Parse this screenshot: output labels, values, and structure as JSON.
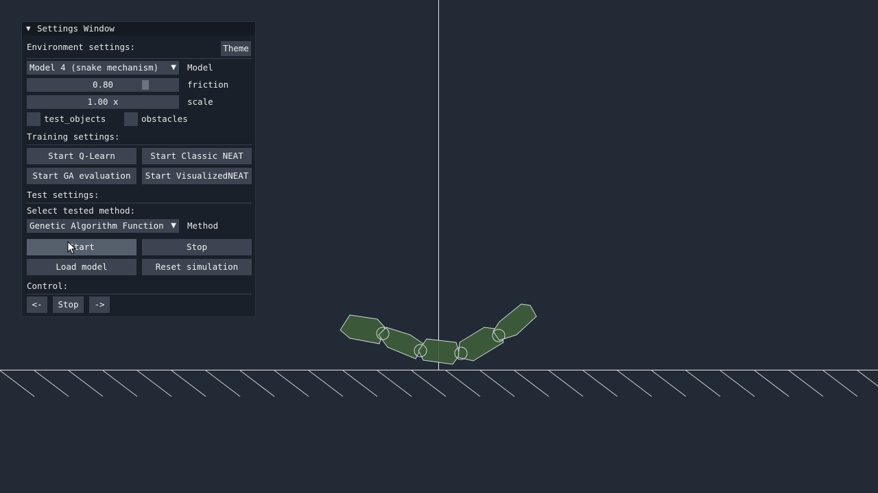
{
  "window": {
    "title": "Settings Window",
    "environment": {
      "heading": "Environment settings:",
      "theme_button": "Theme",
      "model_value": "Model 4 (snake mechanism)",
      "model_label": "Model",
      "friction_value": "0.80",
      "friction_label": "friction",
      "friction_level": 0.8,
      "scale_value": "1.00 x",
      "scale_label": "scale",
      "test_objects_label": "test_objects",
      "test_objects_checked": false,
      "obstacles_label": "obstacles",
      "obstacles_checked": false
    },
    "training": {
      "heading": "Training settings:",
      "start_qlearn": "Start Q-Learn",
      "start_classic_neat": "Start Classic NEAT",
      "start_ga_evaluation": "Start GA evaluation",
      "start_visualized_neat": "Start VisualizedNEAT"
    },
    "test": {
      "heading": "Test settings:",
      "select_label": "Select tested method:",
      "method_value": "Genetic Algorithm Function",
      "method_label": "Method",
      "start_button": "Start",
      "stop_button": "Stop",
      "load_model_button": "Load model",
      "reset_simulation_button": "Reset simulation"
    },
    "control": {
      "heading": "Control:",
      "left_button": "<-",
      "stop_button": "Stop",
      "right_button": "->"
    }
  },
  "colors": {
    "background": "#222a35",
    "window_bg": "#192029",
    "button_bg": "#3b4450",
    "button_hover": "#56606c",
    "segment_fill": "#3e5e3a",
    "outline": "#d0d6dc"
  }
}
